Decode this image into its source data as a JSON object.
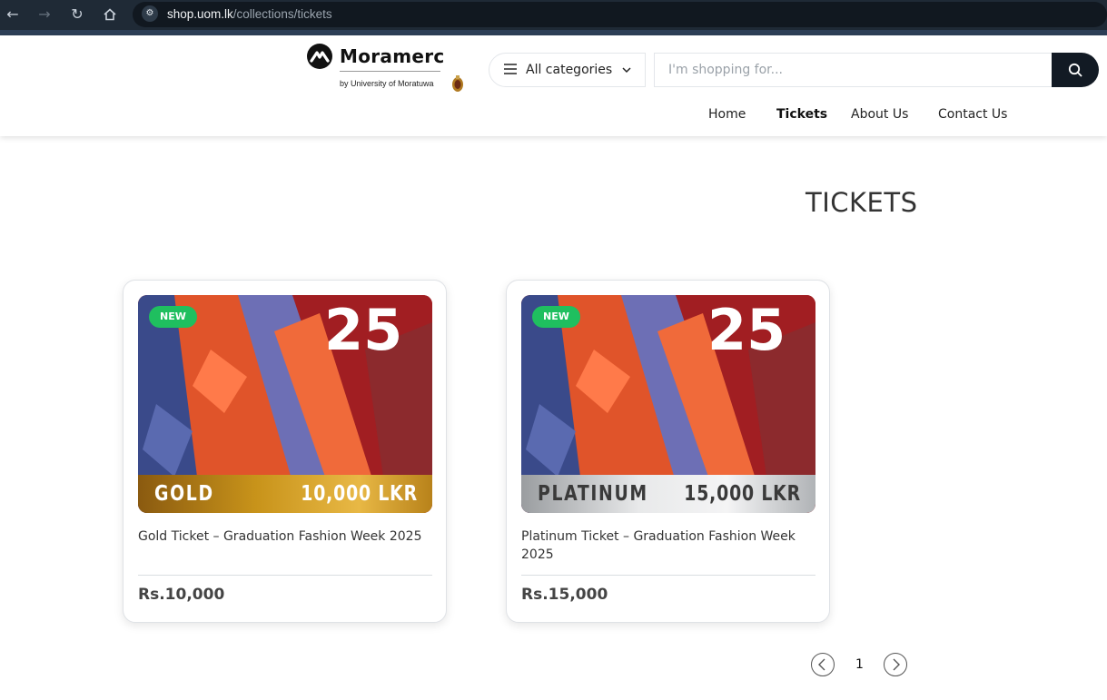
{
  "browser": {
    "url_host": "shop.uom.lk",
    "url_path": "/collections/tickets"
  },
  "header": {
    "brand_name": "Moramerc",
    "brand_sub": "by University of Moratuwa",
    "category_label": "All categories",
    "search_placeholder": "I'm shopping for...",
    "nav": [
      {
        "label": "Home"
      },
      {
        "label": "Tickets"
      },
      {
        "label": "About Us"
      },
      {
        "label": "Contact Us"
      }
    ]
  },
  "page": {
    "title": "TICKETS"
  },
  "products": [
    {
      "badge": "NEW",
      "tier": "GOLD",
      "tier_price": "10,000 LKR",
      "title": "Gold Ticket – Graduation Fashion Week 2025",
      "price": "Rs.10,000",
      "band_color": "#c8931a",
      "band_text_color": "#ffffff"
    },
    {
      "badge": "NEW",
      "tier": "PLATINUM",
      "tier_price": "15,000 LKR",
      "title": "Platinum Ticket – Graduation Fashion Week 2025",
      "price": "Rs.15,000",
      "band_color": "#d4d6d8",
      "band_text_color": "#3a3a3a"
    }
  ],
  "pagination": {
    "current": "1"
  },
  "colors": {
    "accent_dark": "#121a24",
    "badge_green": "#1fbf5f"
  }
}
